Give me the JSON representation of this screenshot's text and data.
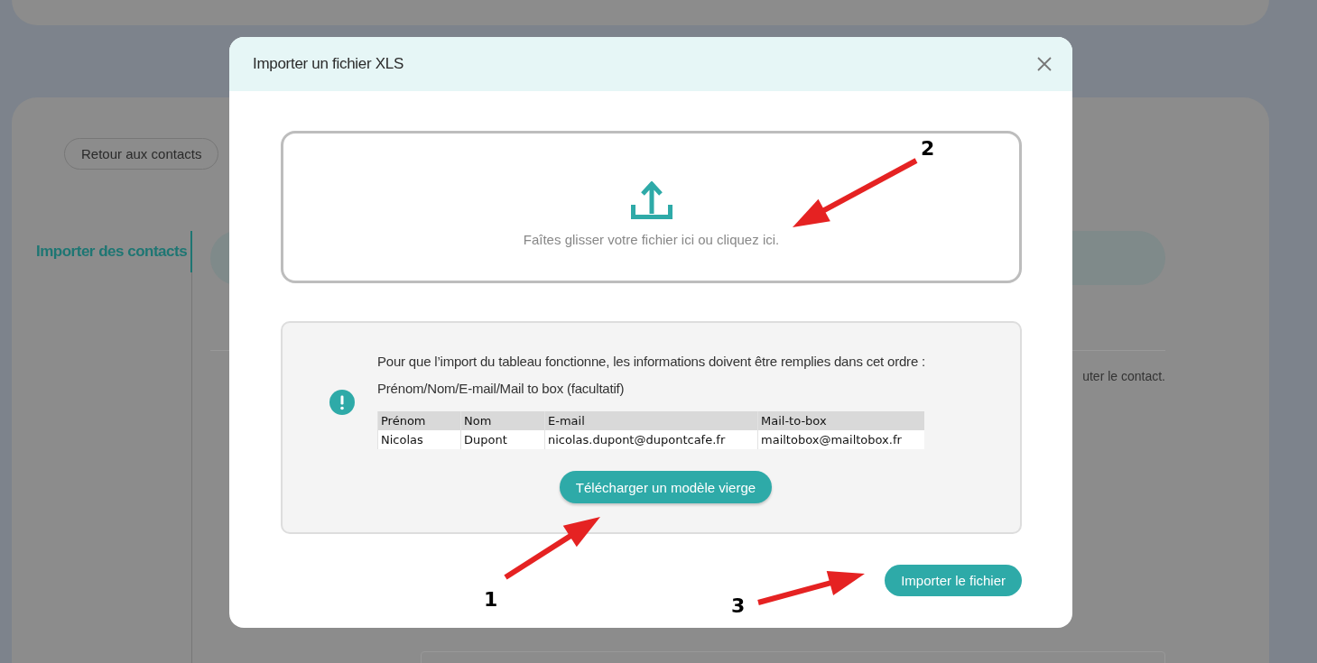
{
  "background": {
    "back_button": "Retour aux contacts",
    "sidebar_items": [
      {
        "label": "Importer des contacts",
        "selected": true
      }
    ],
    "partial_text": "uter le contact."
  },
  "dialog": {
    "title": "Importer un fichier XLS",
    "dropzone_text": "Faîtes glisser votre fichier ici ou cliquez ici.",
    "info": {
      "lines": [
        "Pour que l’import du tableau fonctionne, les informations doivent être remplies dans cet ordre :",
        "Prénom/Nom/E-mail/Mail to box (facultatif)"
      ],
      "table": {
        "columns": [
          "Prénom",
          "Nom",
          "E-mail",
          "Mail-to-box"
        ],
        "rows": [
          [
            "Nicolas",
            "Dupont",
            "nicolas.dupont@dupontcafe.fr",
            "mailtobox@mailtobox.fr"
          ]
        ]
      },
      "download_button": "Télécharger un modèle vierge"
    },
    "import_button": "Importer le fichier"
  },
  "annotations": [
    {
      "label": "2"
    },
    {
      "label": "1"
    },
    {
      "label": "3"
    }
  ]
}
